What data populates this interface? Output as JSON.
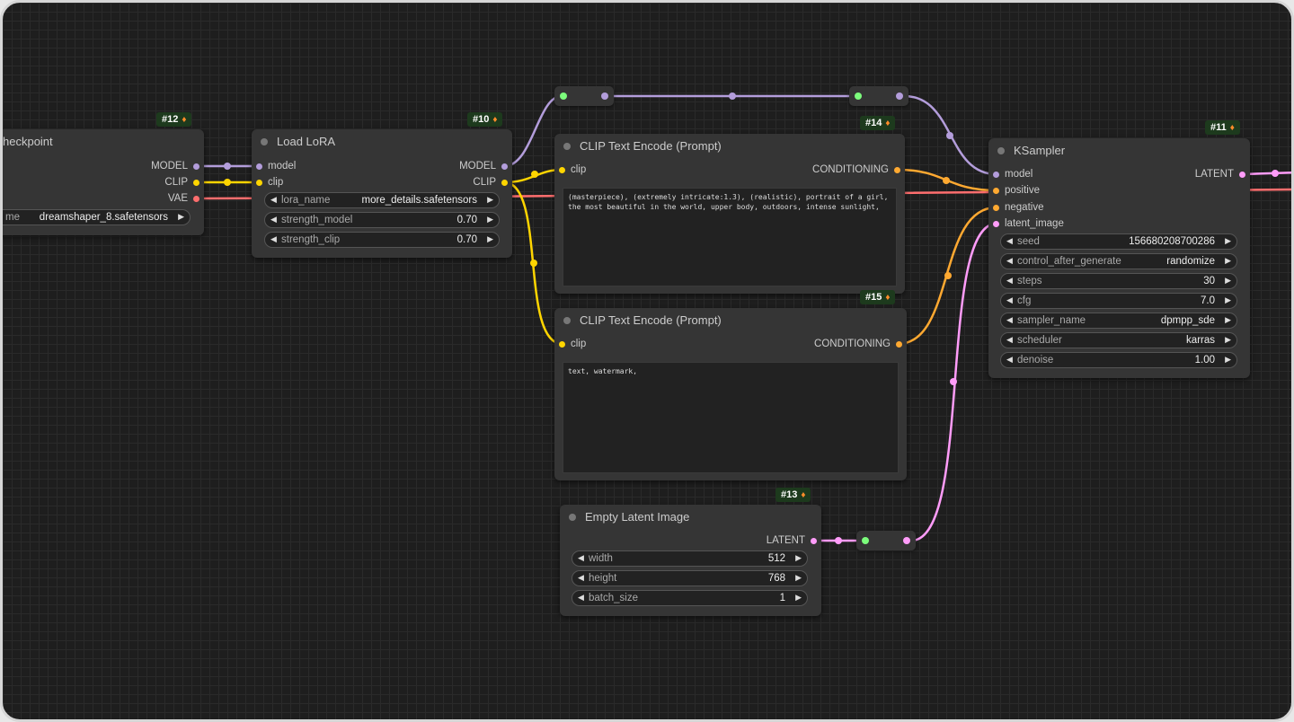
{
  "colors": {
    "model": "#b39ddb",
    "clip": "#ffd500",
    "vae": "#ff6e6e",
    "conditioning": "#ffa931",
    "latent": "#ff9cf9",
    "reroute_in": "#7cfc7c",
    "badge_bg": "#1d3a1d"
  },
  "icons": {
    "badge": "fox-icon",
    "left": "arrow-left-icon",
    "right": "arrow-right-icon"
  },
  "nodes": {
    "checkpoint": {
      "badge": "#12",
      "title": "heckpoint",
      "outputs": [
        "MODEL",
        "CLIP",
        "VAE"
      ],
      "widget": {
        "label": "me",
        "value": "dreamshaper_8.safetensors"
      }
    },
    "lora": {
      "badge": "#10",
      "title": "Load LoRA",
      "inputs": [
        "model",
        "clip"
      ],
      "outputs": [
        "MODEL",
        "CLIP"
      ],
      "widgets": [
        {
          "label": "lora_name",
          "value": "more_details.safetensors"
        },
        {
          "label": "strength_model",
          "value": "0.70"
        },
        {
          "label": "strength_clip",
          "value": "0.70"
        }
      ]
    },
    "clip_pos": {
      "badge": "#14",
      "title": "CLIP Text Encode (Prompt)",
      "input": "clip",
      "output": "CONDITIONING",
      "text": "(masterpiece), (extremely intricate:1.3), (realistic), portrait of a girl, the most beautiful in the world, upper body, outdoors, intense sunlight,"
    },
    "clip_neg": {
      "badge": "#15",
      "title": "CLIP Text Encode (Prompt)",
      "input": "clip",
      "output": "CONDITIONING",
      "text": "text, watermark,"
    },
    "latent": {
      "badge": "#13",
      "title": "Empty Latent Image",
      "output": "LATENT",
      "widgets": [
        {
          "label": "width",
          "value": "512"
        },
        {
          "label": "height",
          "value": "768"
        },
        {
          "label": "batch_size",
          "value": "1"
        }
      ]
    },
    "ksampler": {
      "badge": "#11",
      "title": "KSampler",
      "inputs": [
        "model",
        "positive",
        "negative",
        "latent_image"
      ],
      "output": "LATENT",
      "widgets": [
        {
          "label": "seed",
          "value": "156680208700286"
        },
        {
          "label": "control_after_generate",
          "value": "randomize"
        },
        {
          "label": "steps",
          "value": "30"
        },
        {
          "label": "cfg",
          "value": "7.0"
        },
        {
          "label": "sampler_name",
          "value": "dpmpp_sde"
        },
        {
          "label": "scheduler",
          "value": "karras"
        },
        {
          "label": "denoise",
          "value": "1.00"
        }
      ]
    }
  }
}
